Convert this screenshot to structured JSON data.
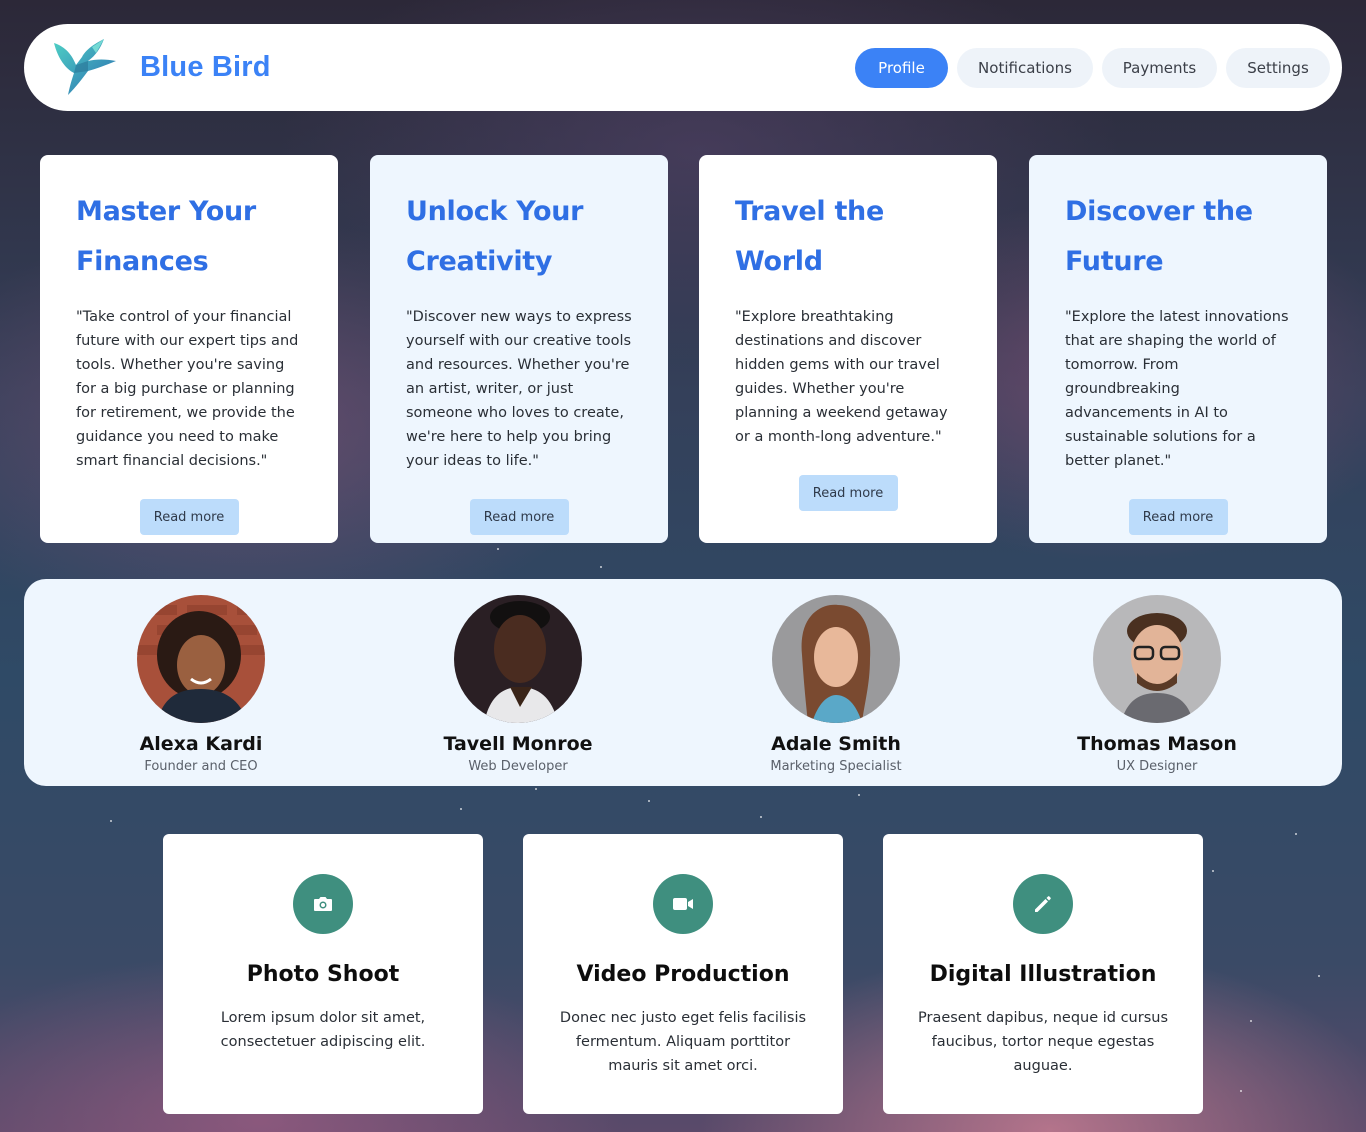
{
  "header": {
    "brand": "Blue Bird",
    "nav": [
      {
        "label": "Profile",
        "active": true
      },
      {
        "label": "Notifications",
        "active": false
      },
      {
        "label": "Payments",
        "active": false
      },
      {
        "label": "Settings",
        "active": false
      }
    ]
  },
  "cards": [
    {
      "title": "Master Your Finances",
      "text": "\"Take control of your financial future with our expert tips and tools. Whether you're saving for a big purchase or planning for retirement, we provide the guidance you need to make smart financial decisions.\"",
      "button": "Read more"
    },
    {
      "title": "Unlock Your Creativity",
      "text": "\"Discover new ways to express yourself with our creative tools and resources. Whether you're an artist, writer, or just someone who loves to create, we're here to help you bring your ideas to life.\"",
      "button": "Read more"
    },
    {
      "title": "Travel the World",
      "text": "\"Explore breathtaking destinations and discover hidden gems with our travel guides. Whether you're planning a weekend getaway or a month-long adventure.\"",
      "button": "Read more"
    },
    {
      "title": "Discover the Future",
      "text": "\"Explore the latest innovations that are shaping the world of tomorrow. From groundbreaking advancements in AI to sustainable solutions for a better planet.\"",
      "button": "Read more"
    }
  ],
  "team": [
    {
      "name": "Alexa Kardi",
      "role": "Founder and CEO"
    },
    {
      "name": "Tavell Monroe",
      "role": "Web Developer"
    },
    {
      "name": "Adale Smith",
      "role": "Marketing Specialist"
    },
    {
      "name": "Thomas Mason",
      "role": "UX Designer"
    }
  ],
  "services": [
    {
      "icon": "camera-icon",
      "title": "Photo Shoot",
      "text": "Lorem ipsum dolor sit amet, consectetuer adipiscing elit."
    },
    {
      "icon": "video-camera-icon",
      "title": "Video Production",
      "text": "Donec nec justo eget felis facilisis fermentum. Aliquam porttitor mauris sit amet orci."
    },
    {
      "icon": "pencil-icon",
      "title": "Digital Illustration",
      "text": "Praesent dapibus, neque id cursus faucibus, tortor neque egestas auguae."
    }
  ],
  "colors": {
    "accent": "#3b82f6",
    "title_blue": "#2f6fe4",
    "service_icon_bg": "#3f8f7f",
    "button_light": "#bcdcfb",
    "card_tint": "#eef6fe"
  }
}
